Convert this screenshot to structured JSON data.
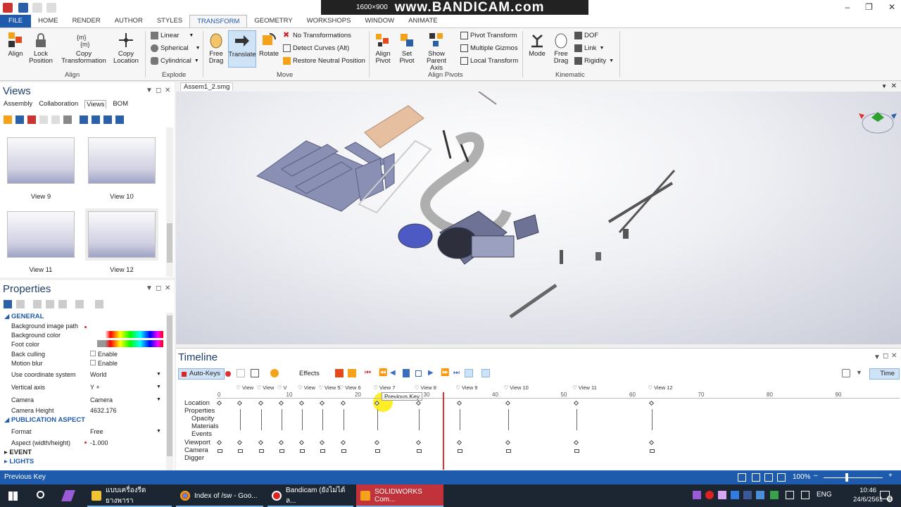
{
  "app": {
    "capture_resolution": "1600×900",
    "capture_brand": "www.BANDICAM.com"
  },
  "tabs": [
    "FILE",
    "HOME",
    "RENDER",
    "AUTHOR",
    "STYLES",
    "TRANSFORM",
    "GEOMETRY",
    "WORKSHOPS",
    "WINDOW",
    "ANIMATE"
  ],
  "active_tab": "TRANSFORM",
  "ribbon": {
    "align_group": {
      "label": "Align",
      "align": "Align",
      "lock_position": "Lock Position",
      "copy_transformation": "Copy Transformation",
      "copy_location": "Copy Location"
    },
    "explode_group": {
      "label": "Explode",
      "linear": "Linear",
      "spherical": "Spherical",
      "cylindrical": "Cylindrical"
    },
    "move_group": {
      "label": "Move",
      "free_drag": "Free Drag",
      "translate": "Translate",
      "rotate": "Rotate",
      "no_transformations": "No Transformations",
      "detect_curves": "Detect Curves (Alt)",
      "restore_neutral": "Restore Neutral Position"
    },
    "pivots_group": {
      "label": "Align Pivots",
      "align_pivot": "Align Pivot",
      "set_pivot": "Set Pivot",
      "show_parent_axis": "Show Parent Axis",
      "pivot_transform": "Pivot Transform",
      "multiple_gizmos": "Multiple Gizmos",
      "local_transform": "Local Transform"
    },
    "kinematic_group": {
      "label": "Kinematic",
      "mode": "Mode",
      "free_drag": "Free Drag",
      "dof": "DOF",
      "link": "Link",
      "rigidity": "Rigidity"
    }
  },
  "views_panel": {
    "title": "Views",
    "subtabs": [
      "Assembly",
      "Collaboration",
      "Views",
      "BOM"
    ],
    "active_subtab": "Views",
    "thumbnails": [
      "View 9",
      "View 10",
      "View 11",
      "View 12"
    ]
  },
  "properties_panel": {
    "title": "Properties",
    "section_general": "GENERAL",
    "rows": [
      {
        "key": "Background image path",
        "value": ""
      },
      {
        "key": "Background color",
        "value": ""
      },
      {
        "key": "Foot color",
        "value": ""
      },
      {
        "key": "Back culling",
        "value": "Enable"
      },
      {
        "key": "Motion blur",
        "value": "Enable"
      },
      {
        "key": "Use coordinate system",
        "value": "World"
      },
      {
        "key": "Vertical axis",
        "value": "Y +"
      },
      {
        "key": "Camera",
        "value": "Camera"
      },
      {
        "key": "Camera Height",
        "value": "4632.176"
      }
    ],
    "section_publication": "PUBLICATION ASPECT",
    "publication_rows": [
      {
        "key": "Format",
        "value": "Free"
      },
      {
        "key": "Aspect (width/height)",
        "value": "-1.000"
      }
    ],
    "section_event": "EVENT",
    "section_lights": "LIGHTS"
  },
  "document": {
    "tab": "Assem1_2.smg"
  },
  "timeline": {
    "title": "Timeline",
    "auto_keys": "Auto-Keys",
    "effects": "Effects",
    "time_button": "Time",
    "tooltip": "Previous Key",
    "row_labels": [
      "Location",
      "Properties",
      "Opacity",
      "Materials",
      "Events",
      "Viewport",
      "Camera",
      "Digger"
    ],
    "ruler_ticks": [
      "0",
      "10",
      "20",
      "30",
      "40",
      "50",
      "60",
      "70",
      "80",
      "90"
    ],
    "view_markers": [
      {
        "label": "View",
        "time": 3
      },
      {
        "label": "View",
        "time": 6
      },
      {
        "label": "V",
        "time": 9
      },
      {
        "label": "View",
        "time": 12
      },
      {
        "label": "View 5",
        "time": 15
      },
      {
        "label": "View 6",
        "time": 18
      },
      {
        "label": "View 7",
        "time": 23
      },
      {
        "label": "View 8",
        "time": 29
      },
      {
        "label": "View 9",
        "time": 35
      },
      {
        "label": "View 10",
        "time": 42
      },
      {
        "label": "View 11",
        "time": 52
      },
      {
        "label": "View 12",
        "time": 63
      }
    ],
    "playhead_time": 32.5
  },
  "status": {
    "text": "Previous Key",
    "zoom": "100%"
  },
  "taskbar": {
    "items": [
      "แบบเครื่องรีดยางพารา",
      "Index of /sw - Goo...",
      "Bandicam (ยังไม่ได้ล...",
      "SOLIDWORKS Com..."
    ],
    "active_item": "SOLIDWORKS Com...",
    "language": "ENG",
    "time": "10:46",
    "date": "24/6/2561",
    "notification_count": "6"
  },
  "colors": {
    "accent": "#1f5bac",
    "playhead": "#e03030",
    "taskbar": "#1b2632"
  }
}
